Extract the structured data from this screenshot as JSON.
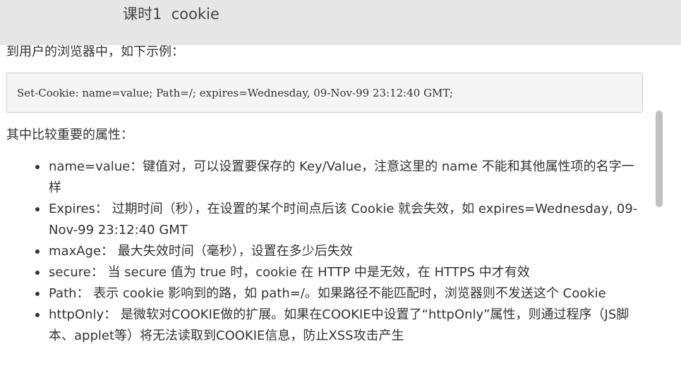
{
  "header": {
    "title": "课时1  cookie"
  },
  "content": {
    "intro": "到用户的浏览器中，如下示例：",
    "code": "Set-Cookie: name=value; Path=/; expires=Wednesday, 09-Nov-99 23:12:40 GMT;",
    "attributes_heading": "其中比较重要的属性：",
    "attributes": [
      "name=value：键值对，可以设置要保存的 Key/Value，注意这里的 name 不能和其他属性项的名字一样",
      "Expires： 过期时间（秒），在设置的某个时间点后该 Cookie 就会失效，如 expires=Wednesday, 09-Nov-99 23:12:40 GMT",
      "maxAge： 最大失效时间（毫秒），设置在多少后失效",
      "secure： 当 secure 值为 true 时，cookie 在 HTTP 中是无效，在 HTTPS 中才有效",
      "Path： 表示 cookie 影响到的路，如 path=/。如果路径不能匹配时，浏览器则不发送这个 Cookie",
      "httpOnly： 是微软对COOKIE做的扩展。如果在COOKIE中设置了“httpOnly”属性，则通过程序（JS脚本、applet等）将无法读取到COOKIE信息，防止XSS攻击产生"
    ]
  },
  "colors": {
    "header_bg": "#e6e6e6",
    "code_bg": "#f5f5f5",
    "scroll_thumb": "#c1c1c1"
  }
}
